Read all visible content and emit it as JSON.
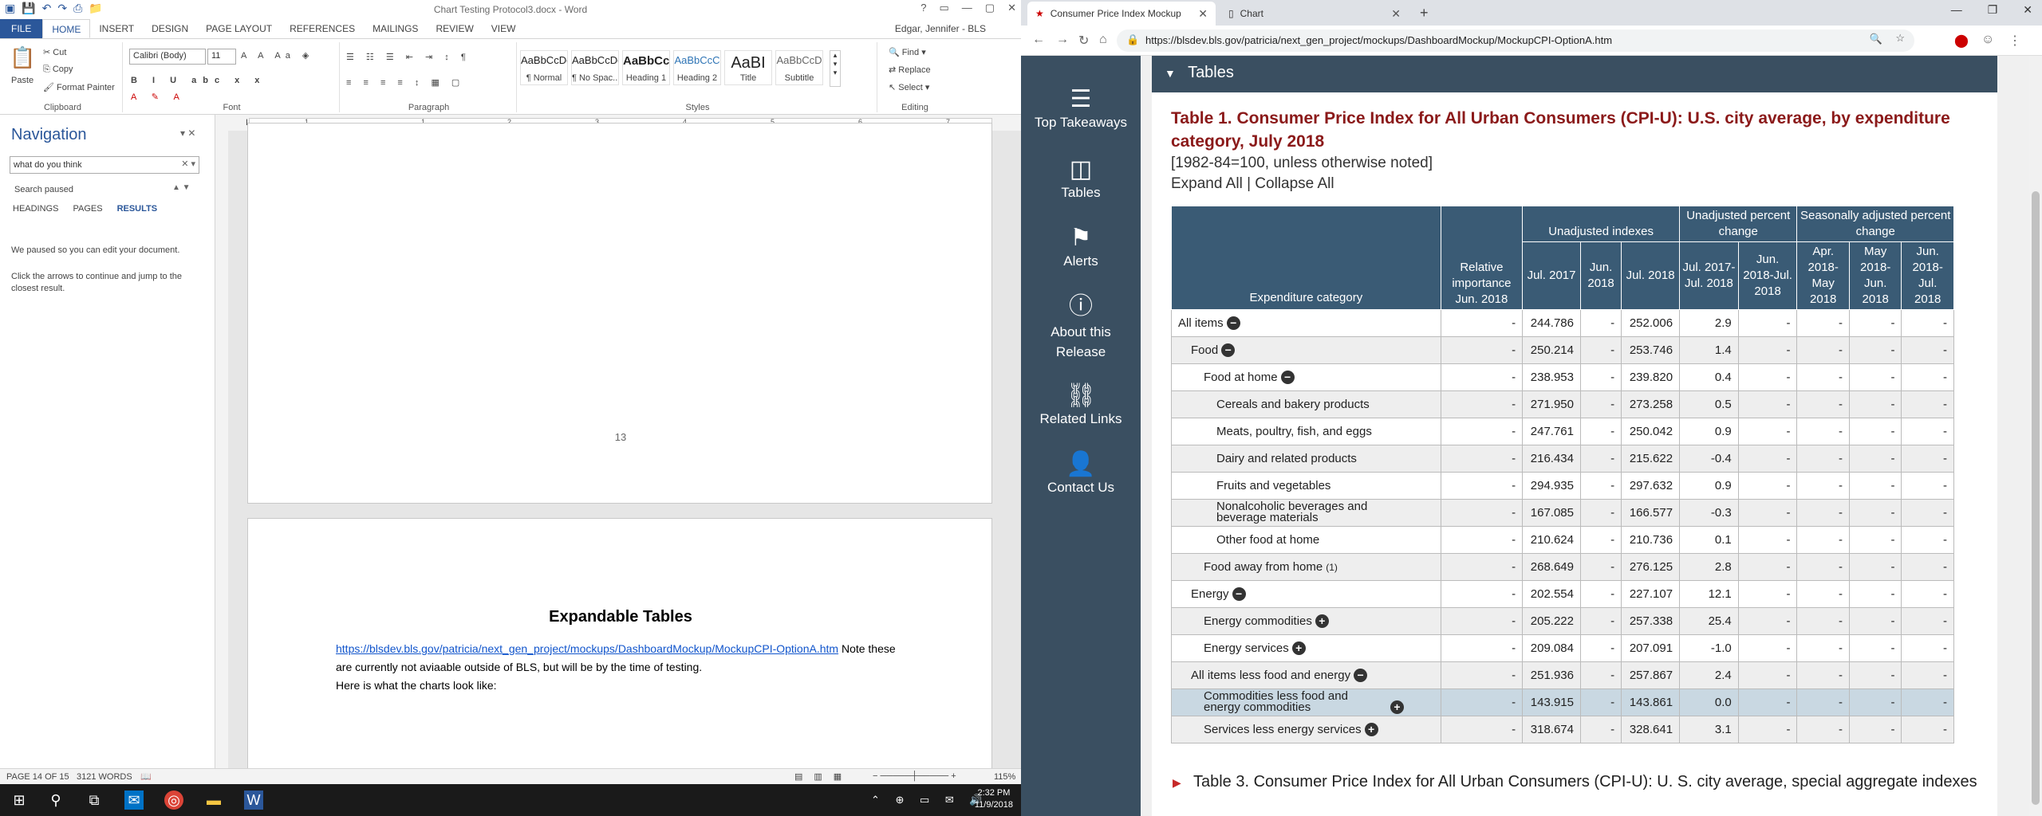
{
  "word": {
    "title": "Chart Testing Protocol3.docx - Word",
    "window_controls": [
      "?",
      "▭",
      "—",
      "▢",
      "✕"
    ],
    "tabs": [
      "FILE",
      "HOME",
      "INSERT",
      "DESIGN",
      "PAGE LAYOUT",
      "REFERENCES",
      "MAILINGS",
      "REVIEW",
      "VIEW"
    ],
    "active_tab": "HOME",
    "user": "Edgar, Jennifer - BLS",
    "clipboard": {
      "paste": "Paste",
      "cut": "Cut",
      "copy": "Copy",
      "format_painter": "Format Painter",
      "label": "Clipboard"
    },
    "font": {
      "name": "Calibri (Body)",
      "size": "11",
      "label": "Font"
    },
    "paragraph_label": "Paragraph",
    "styles": [
      {
        "preview": "AaBbCcDc",
        "name": "¶ Normal"
      },
      {
        "preview": "AaBbCcDc",
        "name": "¶ No Spac..."
      },
      {
        "preview": "AaBbCc",
        "name": "Heading 1"
      },
      {
        "preview": "AaBbCcC",
        "name": "Heading 2"
      },
      {
        "preview": "AaBI",
        "name": "Title"
      },
      {
        "preview": "AaBbCcD",
        "name": "Subtitle"
      }
    ],
    "styles_label": "Styles",
    "editing": {
      "find": "Find",
      "replace": "Replace",
      "select": "Select",
      "label": "Editing"
    },
    "navigation": {
      "title": "Navigation",
      "search_value": "what do you think",
      "status": "Search paused",
      "tabs": [
        "HEADINGS",
        "PAGES",
        "RESULTS"
      ],
      "active_tab": "RESULTS",
      "msg1": "We paused so you can edit your document.",
      "msg2": "Click the arrows to continue and jump to the closest result."
    },
    "ruler_numbers": [
      "1",
      "1",
      "2",
      "3",
      "4",
      "5",
      "6",
      "7"
    ],
    "page_number": "13",
    "doc": {
      "heading": "Expandable Tables",
      "link": "https://blsdev.bls.gov/patricia/next_gen_project/mockups/DashboardMockup/MockupCPI-OptionA.htm",
      "note": " Note these are currently not aviaable outside of BLS, but will be by the time of testing.",
      "line2": "Here is what the charts look like:"
    },
    "status": {
      "page": "PAGE 14 OF 15",
      "words": "3121 WORDS",
      "zoom": "115%"
    }
  },
  "taskbar": {
    "time": "2:32 PM",
    "date": "11/9/2018"
  },
  "chrome": {
    "tabs": [
      {
        "title": "Consumer Price Index Mockup",
        "active": true
      },
      {
        "title": "Chart",
        "active": false
      }
    ],
    "url": "https://blsdev.bls.gov/patricia/next_gen_project/mockups/DashboardMockup/MockupCPI-OptionA.htm"
  },
  "sidebar": [
    {
      "icon": "bars-icon",
      "label": "Top Takeaways"
    },
    {
      "icon": "columns-icon",
      "label": "Tables"
    },
    {
      "icon": "flag-icon",
      "label": "Alerts"
    },
    {
      "icon": "info-icon",
      "label": "About this Release"
    },
    {
      "icon": "link-icon",
      "label": "Related Links"
    },
    {
      "icon": "person-icon",
      "label": "Contact Us"
    }
  ],
  "tables_section": "Tables",
  "table1": {
    "title": "Table 1. Consumer Price Index for All Urban Consumers (CPI-U): U.S. city average, by expenditure category, July 2018",
    "subtitle": "[1982-84=100, unless otherwise noted]",
    "expand": "Expand All | Collapse All",
    "headers": {
      "group_unadj_idx": "Unadjusted indexes",
      "group_unadj_pct": "Unadjusted percent change",
      "group_sa_pct": "Seasonally adjusted percent change",
      "category": "Expenditure category",
      "rel_imp": "Relative importance Jun. 2018",
      "cols": [
        "Jul. 2017",
        "Jun. 2018",
        "Jul. 2018",
        "Jul. 2017-Jul. 2018",
        "Jun. 2018-Jul. 2018",
        "Apr. 2018-May 2018",
        "May 2018-Jun. 2018",
        "Jun. 2018-Jul. 2018"
      ]
    },
    "rows": [
      {
        "name": "All items",
        "indent": 0,
        "toggle": "−",
        "v": [
          "-",
          "244.786",
          "-",
          "252.006",
          "2.9",
          "-",
          "-",
          "-",
          "-"
        ]
      },
      {
        "name": "Food",
        "indent": 1,
        "toggle": "−",
        "v": [
          "-",
          "250.214",
          "-",
          "253.746",
          "1.4",
          "-",
          "-",
          "-",
          "-"
        ]
      },
      {
        "name": "Food at home",
        "indent": 2,
        "toggle": "−",
        "v": [
          "-",
          "238.953",
          "-",
          "239.820",
          "0.4",
          "-",
          "-",
          "-",
          "-"
        ]
      },
      {
        "name": "Cereals and bakery products",
        "indent": 3,
        "toggle": "",
        "v": [
          "-",
          "271.950",
          "-",
          "273.258",
          "0.5",
          "-",
          "-",
          "-",
          "-"
        ]
      },
      {
        "name": "Meats, poultry, fish, and eggs",
        "indent": 3,
        "toggle": "",
        "v": [
          "-",
          "247.761",
          "-",
          "250.042",
          "0.9",
          "-",
          "-",
          "-",
          "-"
        ]
      },
      {
        "name": "Dairy and related products",
        "indent": 3,
        "toggle": "",
        "v": [
          "-",
          "216.434",
          "-",
          "215.622",
          "-0.4",
          "-",
          "-",
          "-",
          "-"
        ]
      },
      {
        "name": "Fruits and vegetables",
        "indent": 3,
        "toggle": "",
        "v": [
          "-",
          "294.935",
          "-",
          "297.632",
          "0.9",
          "-",
          "-",
          "-",
          "-"
        ]
      },
      {
        "name": "Nonalcoholic beverages and beverage materials",
        "indent": 3,
        "toggle": "",
        "v": [
          "-",
          "167.085",
          "-",
          "166.577",
          "-0.3",
          "-",
          "-",
          "-",
          "-"
        ]
      },
      {
        "name": "Other food at home",
        "indent": 3,
        "toggle": "",
        "v": [
          "-",
          "210.624",
          "-",
          "210.736",
          "0.1",
          "-",
          "-",
          "-",
          "-"
        ]
      },
      {
        "name": "Food away from home",
        "indent": 2,
        "toggle": "",
        "note": "(1)",
        "v": [
          "-",
          "268.649",
          "-",
          "276.125",
          "2.8",
          "-",
          "-",
          "-",
          "-"
        ]
      },
      {
        "name": "Energy",
        "indent": 1,
        "toggle": "−",
        "v": [
          "-",
          "202.554",
          "-",
          "227.107",
          "12.1",
          "-",
          "-",
          "-",
          "-"
        ]
      },
      {
        "name": "Energy commodities",
        "indent": 2,
        "toggle": "+",
        "v": [
          "-",
          "205.222",
          "-",
          "257.338",
          "25.4",
          "-",
          "-",
          "-",
          "-"
        ]
      },
      {
        "name": "Energy services",
        "indent": 2,
        "toggle": "+",
        "v": [
          "-",
          "209.084",
          "-",
          "207.091",
          "-1.0",
          "-",
          "-",
          "-",
          "-"
        ]
      },
      {
        "name": "All items less food and energy",
        "indent": 1,
        "toggle": "−",
        "v": [
          "-",
          "251.936",
          "-",
          "257.867",
          "2.4",
          "-",
          "-",
          "-",
          "-"
        ]
      },
      {
        "name": "Commodities less food and energy commodities",
        "indent": 2,
        "toggle": "+",
        "highlight": true,
        "v": [
          "-",
          "143.915",
          "-",
          "143.861",
          "0.0",
          "-",
          "-",
          "-",
          "-"
        ]
      },
      {
        "name": "Services less energy services",
        "indent": 2,
        "toggle": "+",
        "v": [
          "-",
          "318.674",
          "-",
          "328.641",
          "3.1",
          "-",
          "-",
          "-",
          "-"
        ]
      }
    ]
  },
  "table3": "Table 3. Consumer Price Index for All Urban Consumers (CPI-U): U. S. city average, special aggregate indexes"
}
